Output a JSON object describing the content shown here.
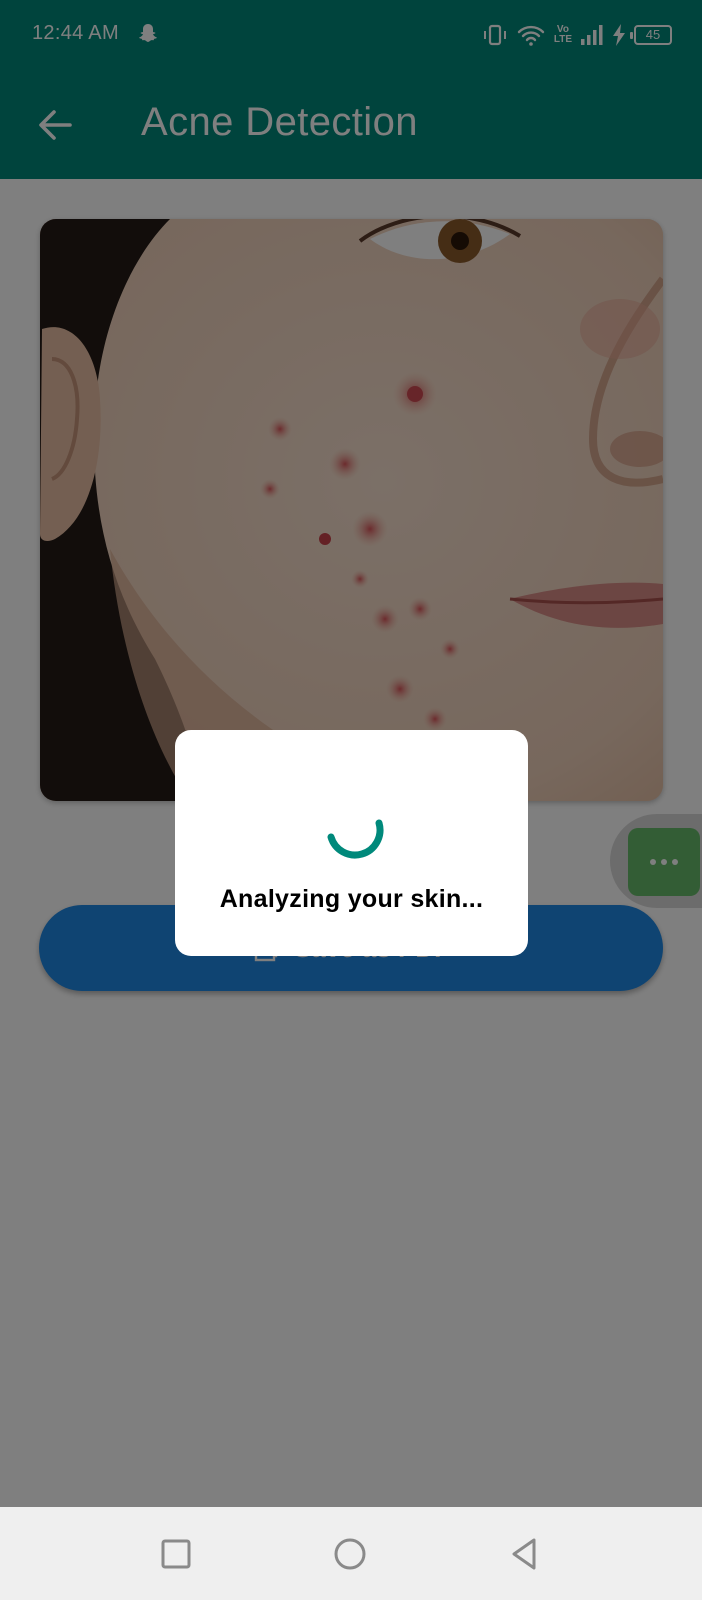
{
  "status_bar": {
    "time": "12:44 AM",
    "icons": [
      "snapchat-icon",
      "vibrate-icon",
      "wifi-icon",
      "volte-icon",
      "signal-icon",
      "charging-icon",
      "battery-icon"
    ],
    "volte_top": "Vo",
    "volte_bottom": "LTE",
    "battery_level": "45"
  },
  "app_bar": {
    "title": "Acne Detection",
    "back_icon": "arrow-left-icon",
    "color": "#00897B"
  },
  "content": {
    "save_button_label": "Save as PDF",
    "save_button_icon": "pdf-icon",
    "save_button_color": "#1E88E5"
  },
  "dialog": {
    "message": "Analyzing your skin...",
    "spinner_color": "#00897B"
  },
  "assist_bubble": {
    "icon": "more-dots-icon",
    "color": "#66bb6a"
  },
  "nav_bar": {
    "buttons": [
      "recents-square-icon",
      "home-circle-icon",
      "back-triangle-icon"
    ]
  }
}
